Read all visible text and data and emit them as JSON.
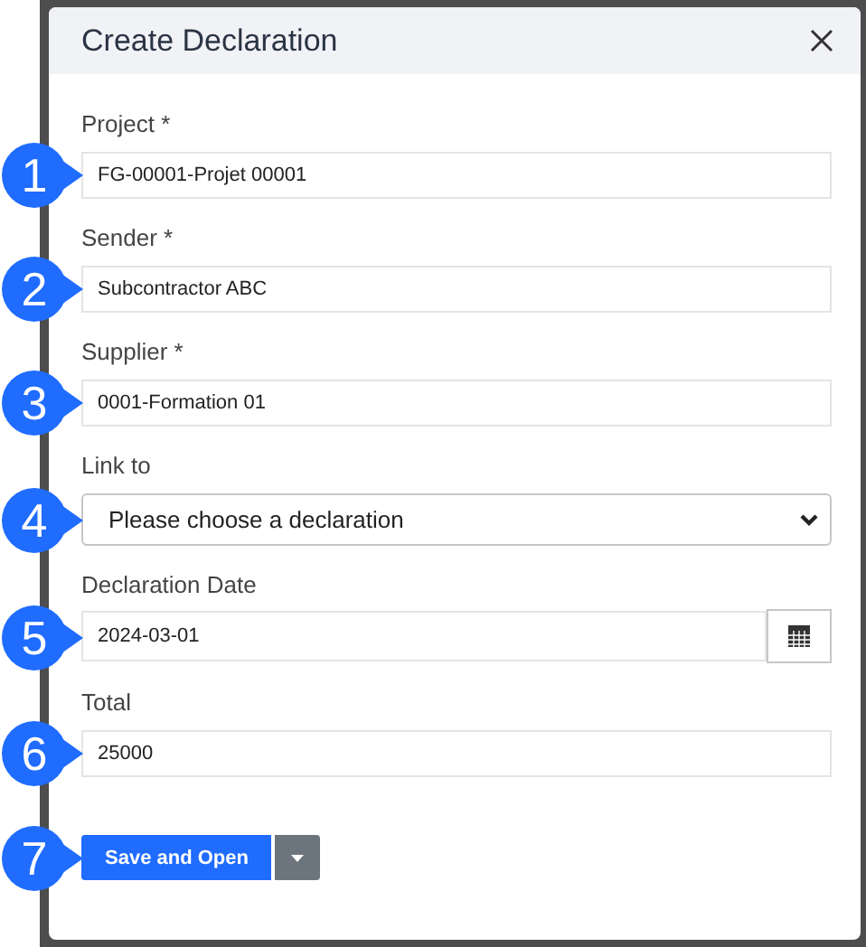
{
  "dialog": {
    "title": "Create Declaration"
  },
  "fields": [
    {
      "kind": "text",
      "label": "Project *",
      "value": "FG-00001-Projet 00001",
      "marker": "1"
    },
    {
      "kind": "text",
      "label": "Sender *",
      "value": "Subcontractor ABC",
      "marker": "2"
    },
    {
      "kind": "text",
      "label": "Supplier *",
      "value": "0001-Formation 01",
      "marker": "3"
    },
    {
      "kind": "select",
      "label": "Link to",
      "value": "Please choose a declaration",
      "marker": "4"
    },
    {
      "kind": "date",
      "label": "Declaration Date",
      "value": "2024-03-01",
      "marker": "5"
    },
    {
      "kind": "text",
      "label": "Total",
      "value": "25000",
      "marker": "6"
    }
  ],
  "actions": {
    "primary": "Save and Open",
    "marker": "7"
  }
}
